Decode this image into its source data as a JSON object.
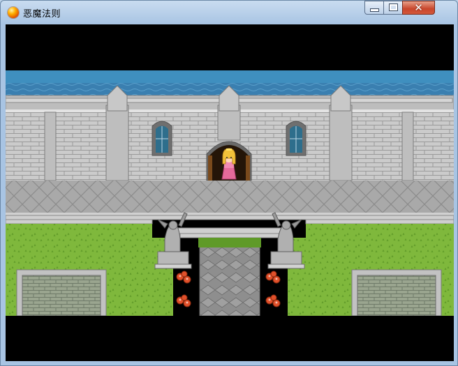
{
  "window": {
    "title": "恶魔法则",
    "icons": {
      "app": "fire-orb-icon",
      "minimize": "minimize-icon",
      "maximize": "maximize-icon",
      "close": "close-icon"
    },
    "close_glyph": "✕"
  },
  "game": {
    "scene": "castle-courtyard",
    "characters": [
      {
        "name": "princess-character",
        "hair": "blonde",
        "dress": "pink"
      }
    ],
    "colors": {
      "sky": "#3f8fbf",
      "wall": "#c9c9c9",
      "grass": "#7fb83c",
      "path": "#8e8e8e",
      "flowers": "#e0502a"
    }
  }
}
